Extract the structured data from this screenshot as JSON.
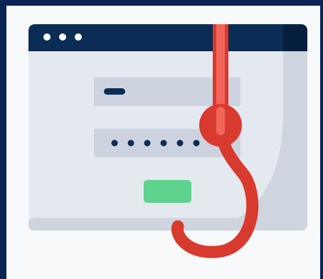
{
  "scene": {
    "description_icons": [
      "browser-window-icon",
      "phishing-hook-icon"
    ],
    "colors": {
      "frame": "#0b2454",
      "background": "#f8f9fb",
      "window_body": "#e4e8ef",
      "window_shade": "#cfd5df",
      "title_bar": "#0b2c54",
      "title_bar_dark": "#071f3e",
      "title_dots": "#ffffff",
      "field_fill": "#cdd3de",
      "field_text": "#0b2c54",
      "submit_button": "#5fd38d",
      "hook_red": "#d83a2e",
      "hook_highlight": "#f2655a"
    },
    "login_form": {
      "password_dot_count": 6
    }
  }
}
